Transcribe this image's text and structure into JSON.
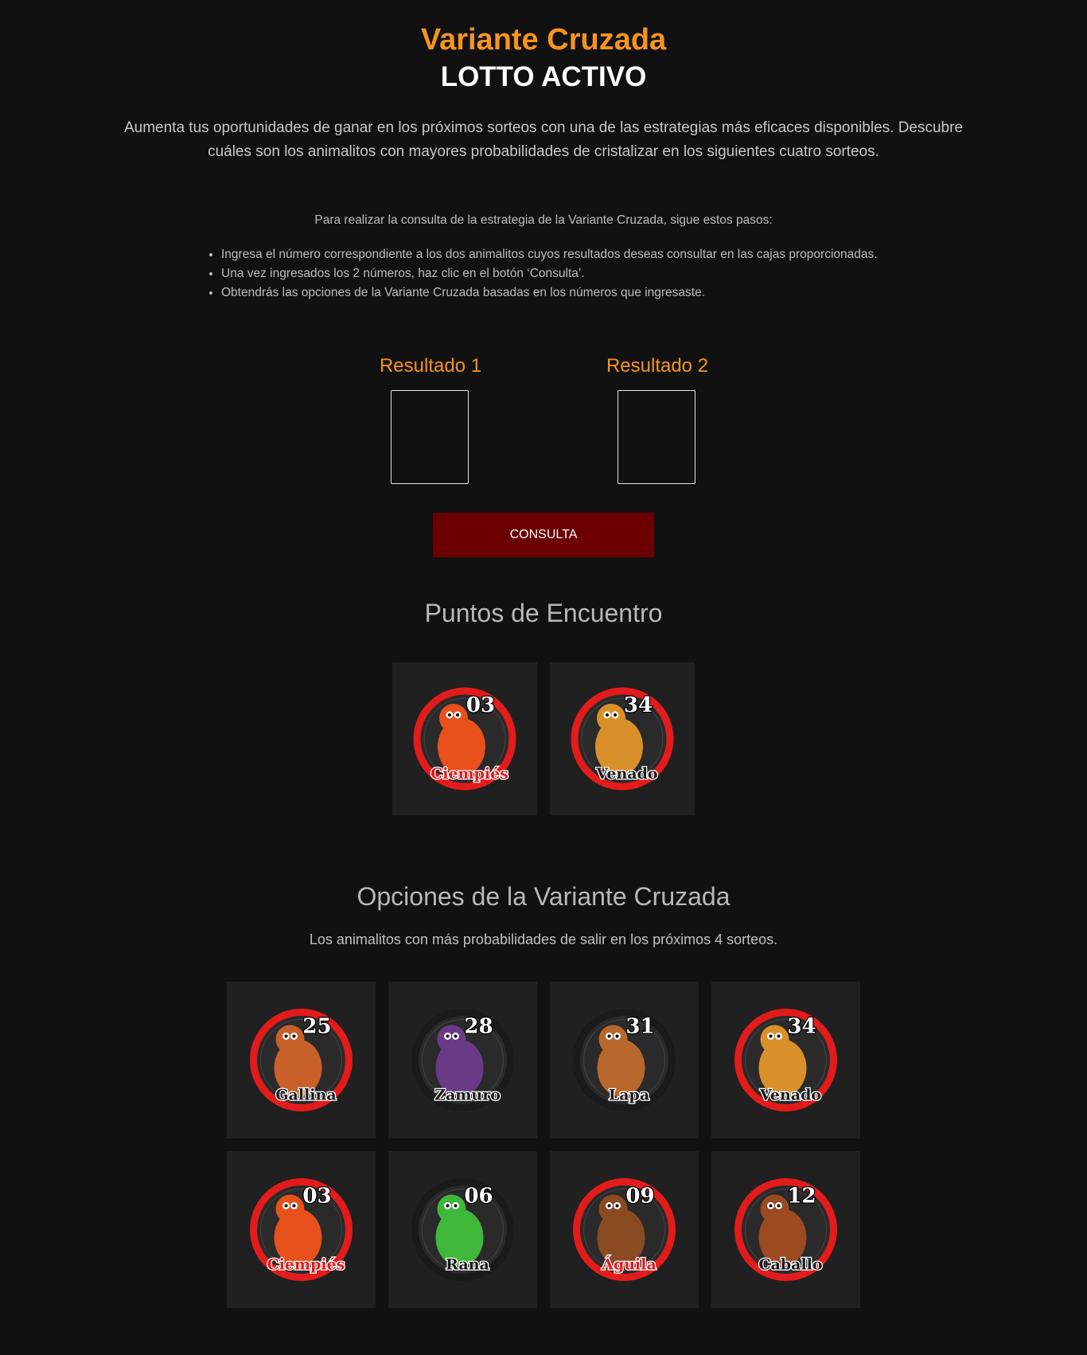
{
  "header": {
    "title": "Variante Cruzada",
    "subtitle": "LOTTO ACTIVO"
  },
  "intro": "Aumenta tus oportunidades de ganar en los próximos sorteos con una de las estrategias más eficaces disponibles. Descubre cuáles son los animalitos con mayores probabilidades de cristalizar en los siguientes cuatro sorteos.",
  "steps": {
    "intro": "Para realizar la consulta de la estrategia de la Variante Cruzada, sigue estos pasos:",
    "items": [
      "Ingresa el número correspondiente a los dos animalitos cuyos resultados deseas consultar en las cajas proporcionadas.",
      "Una vez ingresados los 2 números, haz clic en el botón ‘Consulta’.",
      "Obtendrás las opciones de la Variante Cruzada basadas en los números que ingresaste."
    ]
  },
  "form": {
    "result1_label": "Resultado 1",
    "result1_value": "",
    "result2_label": "Resultado 2",
    "result2_value": "",
    "button_label": "CONSULTA"
  },
  "meeting_points": {
    "title": "Puntos de Encuentro",
    "items": [
      {
        "number": "03",
        "name": "Ciempiés",
        "icon": "centipede-icon",
        "ring": "red"
      },
      {
        "number": "34",
        "name": "Venado",
        "icon": "deer-icon",
        "ring": "red"
      }
    ]
  },
  "options": {
    "title": "Opciones de la Variante Cruzada",
    "subtitle": "Los animalitos con más probabilidades de salir en los próximos 4 sorteos.",
    "items": [
      {
        "number": "25",
        "name": "Gallina",
        "icon": "hen-icon",
        "ring": "red"
      },
      {
        "number": "28",
        "name": "Zamuro",
        "icon": "vulture-icon",
        "ring": "black"
      },
      {
        "number": "31",
        "name": "Lapa",
        "icon": "paca-icon",
        "ring": "black"
      },
      {
        "number": "34",
        "name": "Venado",
        "icon": "deer-icon",
        "ring": "red"
      },
      {
        "number": "03",
        "name": "Ciempiés",
        "icon": "centipede-icon",
        "ring": "red"
      },
      {
        "number": "06",
        "name": "Rana",
        "icon": "frog-icon",
        "ring": "black"
      },
      {
        "number": "09",
        "name": "Águila",
        "icon": "eagle-icon",
        "ring": "red"
      },
      {
        "number": "12",
        "name": "Caballo",
        "icon": "horse-icon",
        "ring": "red"
      }
    ]
  },
  "colors": {
    "background": "#111111",
    "accent": "#f7941d",
    "button": "#6b0000",
    "card": "#202020",
    "ring_red": "#e31b1b",
    "ring_black": "#1a1a1a"
  }
}
